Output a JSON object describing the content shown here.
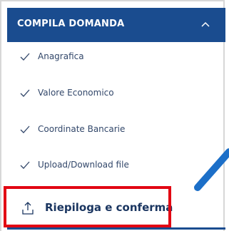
{
  "header": {
    "title": "COMPILA DOMANDA",
    "toggle_icon": "chevron-up-icon"
  },
  "steps": [
    {
      "label": "Anagrafica",
      "status": "completed",
      "icon": "check-icon"
    },
    {
      "label": "Valore Economico",
      "status": "completed",
      "icon": "check-icon"
    },
    {
      "label": "Coordinate Bancarie",
      "status": "completed",
      "icon": "check-icon"
    },
    {
      "label": "Upload/Download file",
      "status": "completed",
      "icon": "check-icon"
    }
  ],
  "active_step": {
    "label": "Riepiloga e conferma",
    "icon": "upload-icon"
  },
  "colors": {
    "header_bg": "#1a4c8f",
    "text": "#32476a",
    "highlight": "#e20613",
    "annotation_stroke": "#1c6fc8"
  }
}
